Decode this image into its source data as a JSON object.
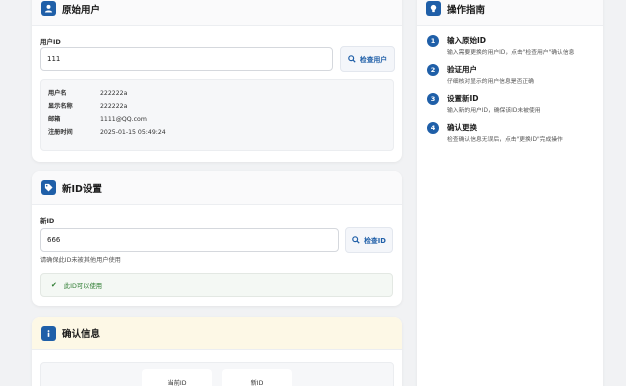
{
  "original": {
    "title": "原始用户",
    "user_id_label": "用户ID",
    "user_id_value": "111",
    "check_button": "检查用户",
    "info": [
      {
        "key": "用户名",
        "value": "222222a"
      },
      {
        "key": "显示名称",
        "value": "222222a"
      },
      {
        "key": "邮箱",
        "value": "1111@QQ.com"
      },
      {
        "key": "注册时间",
        "value": "2025-01-15 05:49:24"
      }
    ]
  },
  "newid": {
    "title": "新ID设置",
    "label": "新ID",
    "value": "666",
    "check_button": "检查ID",
    "hint": "请确保此ID未被其他用户使用",
    "status": "此ID可以使用"
  },
  "confirm": {
    "title": "确认信息",
    "current_label": "当前ID",
    "new_label": "新ID"
  },
  "guide": {
    "title": "操作指南",
    "steps": [
      {
        "num": "1",
        "title": "输入原始ID",
        "desc": "输入需要更换的用户ID，点击\"检查用户\"确认信息"
      },
      {
        "num": "2",
        "title": "验证用户",
        "desc": "仔细核对显示的用户信息是否正确"
      },
      {
        "num": "3",
        "title": "设置新ID",
        "desc": "输入新的用户ID，确保该ID未被使用"
      },
      {
        "num": "4",
        "title": "确认更换",
        "desc": "检查确认信息无误后，点击\"更换ID\"完成操作"
      }
    ]
  },
  "colors": {
    "accent": "#1f5fa8",
    "success": "#2a7a2e",
    "confirm_bg": "#fdf8e6"
  }
}
